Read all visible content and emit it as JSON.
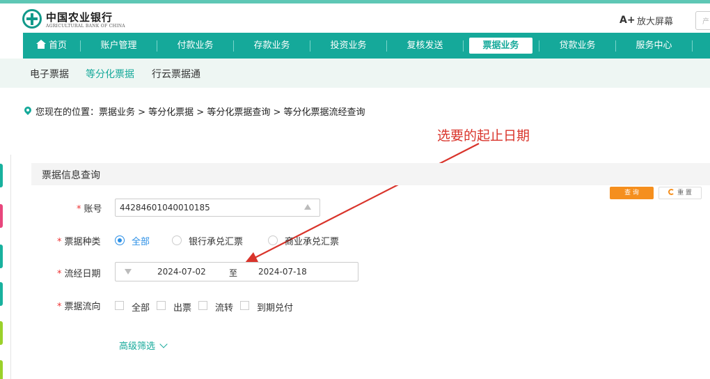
{
  "header": {
    "bank_name_cn": "中国农业银行",
    "bank_name_en": "AGRICULTURAL BANK OF CHINA",
    "font_size_label": "A+",
    "zoom_label": "放大屏幕",
    "search_placeholder": "产"
  },
  "nav": {
    "items": [
      {
        "label": "首页",
        "icon": "home-icon"
      },
      {
        "label": "账户管理"
      },
      {
        "label": "付款业务"
      },
      {
        "label": "存款业务"
      },
      {
        "label": "投资业务"
      },
      {
        "label": "复核发送"
      },
      {
        "label": "票据业务",
        "active": true
      },
      {
        "label": "贷款业务"
      },
      {
        "label": "服务中心"
      }
    ]
  },
  "subnav": {
    "items": [
      {
        "label": "电子票据"
      },
      {
        "label": "等分化票据",
        "active": true
      },
      {
        "label": "行云票据通"
      }
    ]
  },
  "breadcrumb": {
    "prefix": "您现在的位置：",
    "path": "票据业务 > 等分化票据 > 等分化票据查询 > 等分化票据流经查询"
  },
  "annotation": {
    "text": "选要的起止日期",
    "color": "#d9342b"
  },
  "section": {
    "title": "票据信息查询"
  },
  "buttons": {
    "search_label": "查 询",
    "reset_label": "重 置"
  },
  "form": {
    "account": {
      "label": "账号",
      "value": "44284601040010185"
    },
    "bill_type": {
      "label": "票据种类",
      "options": [
        {
          "label": "全部",
          "selected": true
        },
        {
          "label": "银行承兑汇票",
          "selected": false
        },
        {
          "label": "商业承兑汇票",
          "selected": false
        }
      ]
    },
    "flow_date": {
      "label": "流经日期",
      "start": "2024-07-02",
      "separator": "至",
      "end": "2024-07-18"
    },
    "bill_direction": {
      "label": "票据流向",
      "options": [
        {
          "label": "全部",
          "checked": false
        },
        {
          "label": "出票",
          "checked": false
        },
        {
          "label": "流转",
          "checked": false
        },
        {
          "label": "到期兑付",
          "checked": false
        }
      ]
    },
    "advanced_label": "高级筛选"
  },
  "colors": {
    "brand": "#15a99a",
    "accent_orange": "#f58f1e",
    "radio_blue": "#2b8fe6",
    "side_tabs": [
      "#18b19e",
      "#e8467c",
      "#18b19e",
      "#18b19e",
      "#9bd12a",
      "#9bd12a"
    ]
  }
}
